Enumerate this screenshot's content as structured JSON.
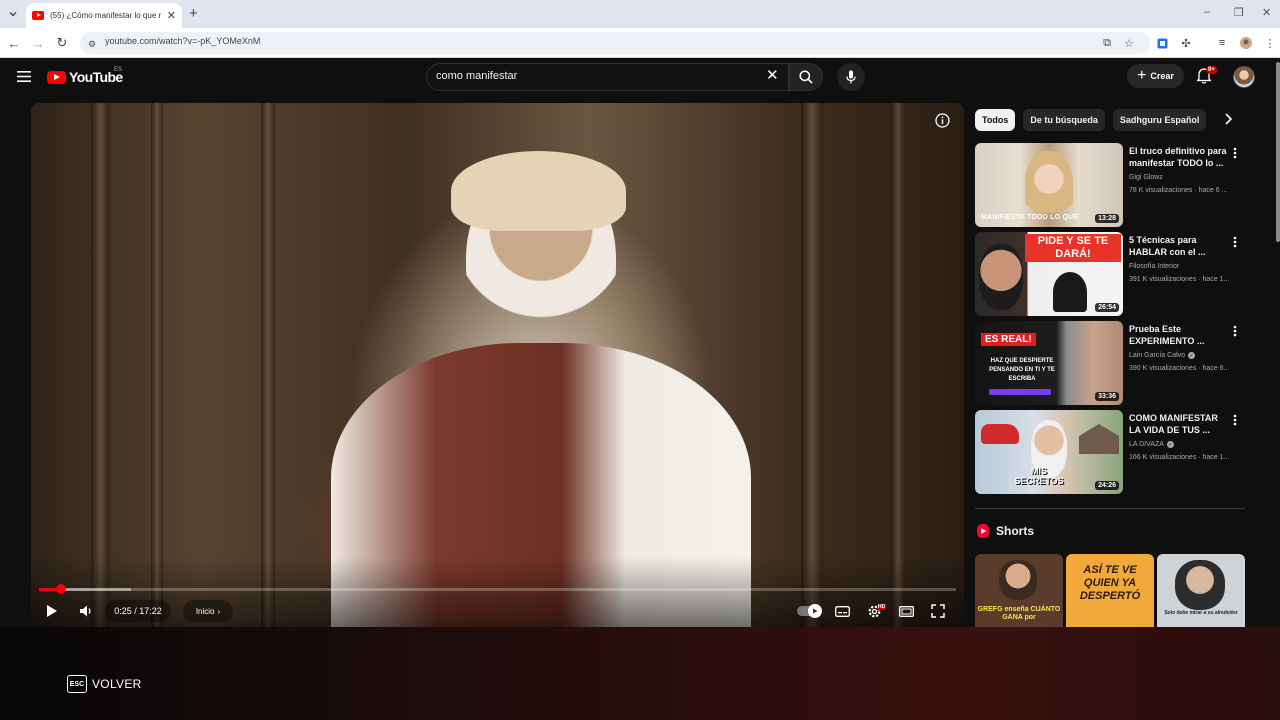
{
  "browser": {
    "tab_title": "(55) ¿Cómo manifestar lo que r",
    "url": "youtube.com/watch?v=-pK_YOMeXnM"
  },
  "header": {
    "logo_text": "YouTube",
    "country_code": "ES",
    "search_value": "como manifestar",
    "create_label": "Crear",
    "notification_count": "9+"
  },
  "player": {
    "time_display": "0:25 / 17:22",
    "chapter_label": "Inicio",
    "progress_fraction": 0.024,
    "buffered_fraction": 0.1
  },
  "chips": [
    "Todos",
    "De tu búsqueda",
    "Sadhguru Español"
  ],
  "recommendations": [
    {
      "title": "El truco definitivo para manifestar TODO lo ...",
      "channel": "Gigi Glowz",
      "verified": false,
      "meta": "78 K visualizaciones · hace 6 ...",
      "duration": "13:28",
      "thumb_text": "MANIFIESTA TODO LO QUE",
      "thumb_color": "#c7b79f"
    },
    {
      "title": "5 Técnicas para HABLAR con el ...",
      "channel": "Filosofía Interior",
      "verified": false,
      "meta": "391 K visualizaciones · hace 1...",
      "duration": "26:54",
      "thumb_text": "PIDE Y SE TE DARÁ!",
      "thumb_color": "#e84a2c"
    },
    {
      "title": "Prueba Este EXPERIMENTO ...",
      "channel": "Lain García Calvo",
      "verified": true,
      "meta": "390 K visualizaciones · hace 6...",
      "duration": "33:36",
      "thumb_text": "ES REAL!",
      "thumb_subtext": "HAZ QUE DESPIERTE PENSANDO EN TI Y TE ESCRIBA",
      "thumb_color": "#1b1b1b"
    },
    {
      "title": "COMO MANIFESTAR LA VIDA DE TUS ...",
      "channel": "LA DIVAZA",
      "verified": true,
      "meta": "166 K visualizaciones · hace 1...",
      "duration": "24:26",
      "thumb_text": "MIS SECRETOS",
      "thumb_color": "#9fb9cf"
    }
  ],
  "shorts": {
    "heading": "Shorts",
    "items": [
      {
        "text": "GREFG enseña CUÁNTO GANA por",
        "bg": "#5a3b2a",
        "fg": "#ffe44d"
      },
      {
        "text": "ASÍ TE VE QUIEN YA DESPERTÓ",
        "bg": "#f2a93b",
        "fg": "#2a1a0a"
      },
      {
        "text": "Solo debe mirar a su alrededor",
        "bg": "#cfd3d6",
        "fg": "#222222"
      }
    ]
  },
  "overlay": {
    "esc_key": "ESC",
    "back_label": "VOLVER"
  },
  "colors": {
    "accent_red": "#ff0000",
    "background": "#0f0f0f"
  }
}
